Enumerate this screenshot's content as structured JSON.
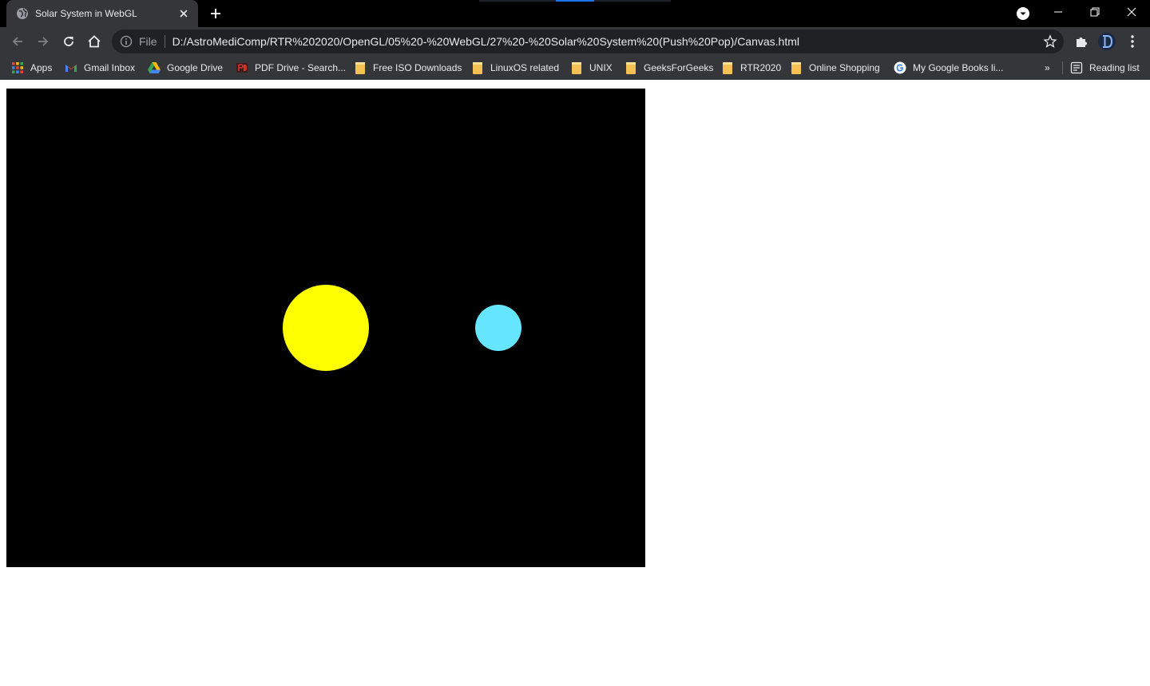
{
  "tab": {
    "title": "Solar System in WebGL",
    "favicon": "globe-icon",
    "close_icon": "close-icon"
  },
  "toolbar": {
    "back_icon": "arrow-left-icon",
    "forward_icon": "arrow-right-icon",
    "reload_icon": "reload-icon",
    "home_icon": "home-icon",
    "scheme_label": "File",
    "url": "D:/AstroMediComp/RTR%202020/OpenGL/05%20-%20WebGL/27%20-%20Solar%20System%20(Push%20Pop)/Canvas.html",
    "bookmark_icon": "star-icon",
    "extensions_icon": "puzzle-icon",
    "menu_icon": "kebab-icon"
  },
  "bookmarks": {
    "items": [
      {
        "label": "Apps",
        "icon": "apps-grid-icon"
      },
      {
        "label": "Gmail Inbox",
        "icon": "gmail-icon"
      },
      {
        "label": "Google Drive",
        "icon": "drive-icon"
      },
      {
        "label": "PDF Drive - Search...",
        "icon": "pdf-icon"
      },
      {
        "label": "Free ISO Downloads",
        "icon": "folder-icon"
      },
      {
        "label": "LinuxOS related",
        "icon": "folder-icon"
      },
      {
        "label": "UNIX",
        "icon": "folder-icon"
      },
      {
        "label": "GeeksForGeeks",
        "icon": "folder-icon"
      },
      {
        "label": "RTR2020",
        "icon": "folder-icon"
      },
      {
        "label": "Online Shopping",
        "icon": "folder-icon"
      },
      {
        "label": "My Google Books li...",
        "icon": "google-icon"
      }
    ],
    "overflow_label": "»",
    "reading_list": "Reading list"
  },
  "scene": {
    "background": "#000000",
    "sun_color": "#ffff00",
    "planet_color": "#66e5ff"
  },
  "colors": {
    "chrome_dark": "#000000",
    "toolbar": "#35363a",
    "omnibox": "#202124",
    "text": "#e8eaed",
    "accent": "#8ab4f8"
  }
}
